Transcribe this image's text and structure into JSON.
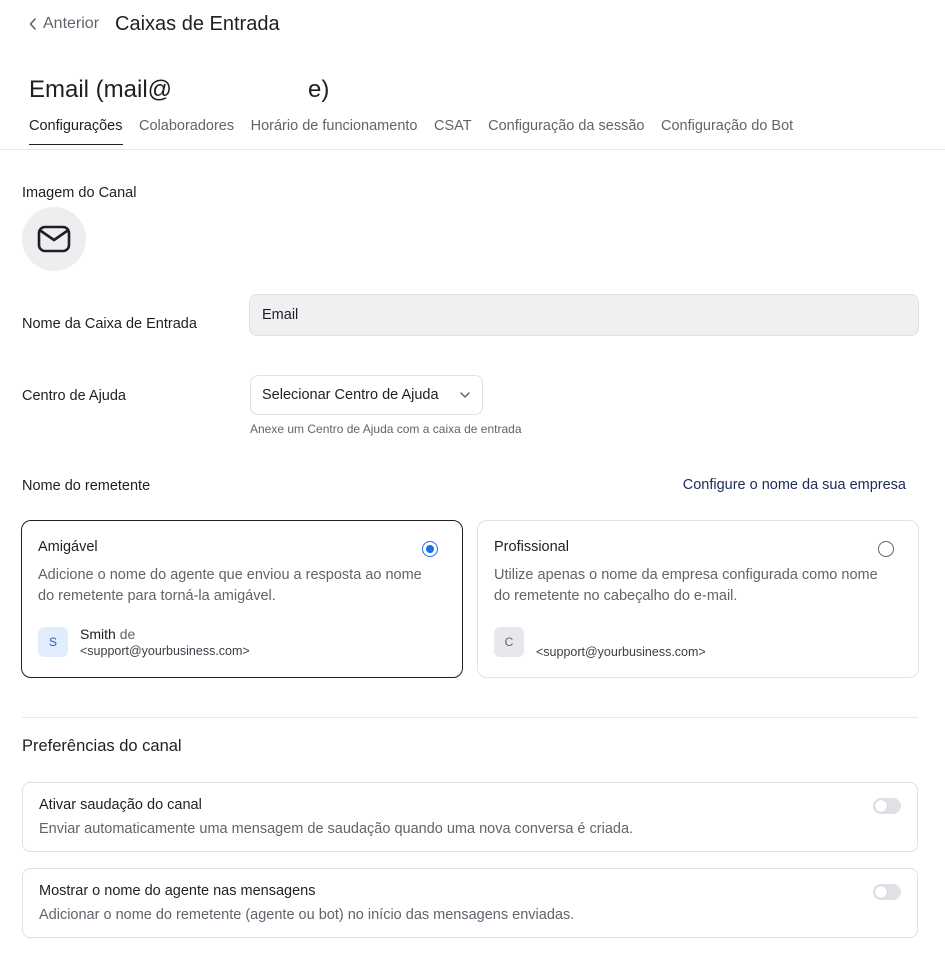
{
  "header": {
    "back_label": "Anterior",
    "page_title": "Caixas de Entrada"
  },
  "inbox": {
    "title_start": "Email (mail@",
    "title_end": "e)"
  },
  "tabs": [
    {
      "label": "Configurações",
      "active": true
    },
    {
      "label": "Colaboradores",
      "active": false
    },
    {
      "label": "Horário de funcionamento",
      "active": false
    },
    {
      "label": "CSAT",
      "active": false
    },
    {
      "label": "Configuração da sessão",
      "active": false
    },
    {
      "label": "Configuração do Bot",
      "active": false
    }
  ],
  "channel_image": {
    "label": "Imagem do Canal",
    "icon": "mail-icon"
  },
  "inbox_name": {
    "label": "Nome da Caixa de Entrada",
    "value": "Email"
  },
  "help_center": {
    "label": "Centro de Ajuda",
    "selected": "Selecionar Centro de Ajuda",
    "help_text": "Anexe um Centro de Ajuda com a caixa de entrada"
  },
  "sender_name": {
    "label": "Nome do remetente",
    "config_link": "Configure o nome da sua empresa",
    "options": [
      {
        "title": "Amigável",
        "description": "Adicione o nome do agente que enviou a resposta ao nome do remetente para torná-la amigável.",
        "selected": true,
        "avatar_letter": "S",
        "sender_name": "Smith",
        "sender_joiner": "de",
        "sender_email": "<support@yourbusiness.com>"
      },
      {
        "title": "Profissional",
        "description": "Utilize apenas o nome da empresa configurada como nome do remetente no cabeçalho do e-mail.",
        "selected": false,
        "avatar_letter": "C",
        "sender_email": "<support@yourbusiness.com>"
      }
    ]
  },
  "preferences": {
    "title": "Preferências do canal",
    "items": [
      {
        "title": "Ativar saudação do canal",
        "description": "Enviar automaticamente uma mensagem de saudação quando uma nova conversa é criada.",
        "enabled": false
      },
      {
        "title": "Mostrar o nome do agente nas mensagens",
        "description": "Adicionar o nome do remetente (agente ou bot) no início das mensagens enviadas.",
        "enabled": false
      }
    ]
  },
  "colors": {
    "accent": "#1f6feb",
    "text": "#1c2024",
    "muted": "#60646c",
    "border": "#e0e1e6"
  }
}
